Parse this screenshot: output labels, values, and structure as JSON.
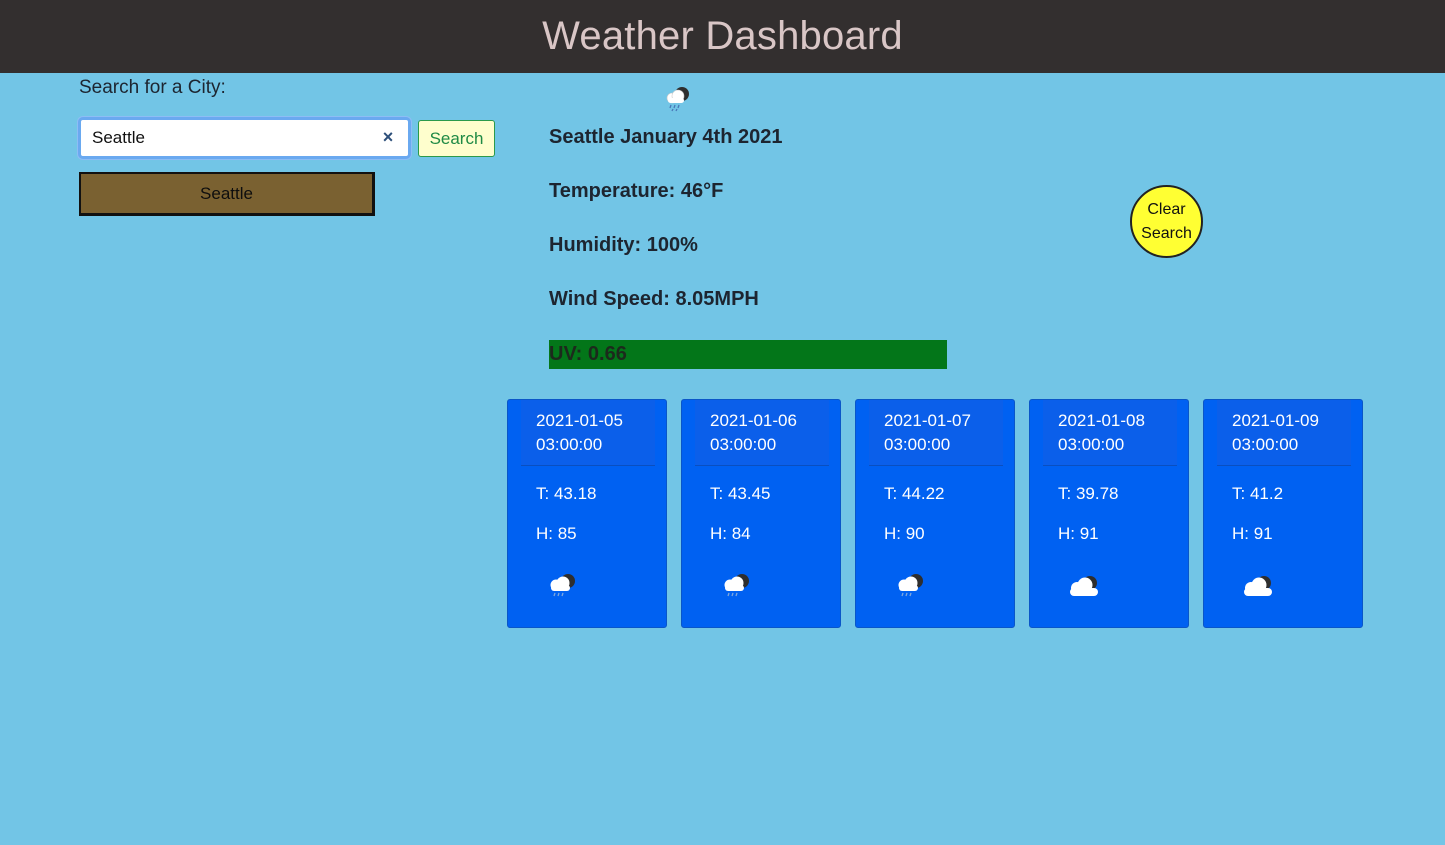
{
  "header": {
    "title": "Weather Dashboard"
  },
  "search": {
    "label": "Search for a City:",
    "value": "Seattle",
    "button_label": "Search",
    "clear_glyph": "×"
  },
  "history": [
    {
      "label": "Seattle"
    }
  ],
  "current": {
    "icon": "rain-cloud-icon",
    "title": "Seattle January 4th 2021",
    "temperature": "Temperature: 46°F",
    "humidity": "Humidity: 100%",
    "wind": "Wind Speed: 8.05MPH",
    "uv": "UV: 0.66",
    "uv_color": "#037619"
  },
  "clear_search": {
    "label": "Clear Search"
  },
  "forecast": [
    {
      "date": "2021-01-05 03:00:00",
      "temp": "T: 43.18",
      "humidity": "H: 85",
      "icon": "rain-cloud-icon"
    },
    {
      "date": "2021-01-06 03:00:00",
      "temp": "T: 43.45",
      "humidity": "H: 84",
      "icon": "rain-cloud-icon"
    },
    {
      "date": "2021-01-07 03:00:00",
      "temp": "T: 44.22",
      "humidity": "H: 90",
      "icon": "rain-cloud-icon"
    },
    {
      "date": "2021-01-08 03:00:00",
      "temp": "T: 39.78",
      "humidity": "H: 91",
      "icon": "cloud-icon"
    },
    {
      "date": "2021-01-09 03:00:00",
      "temp": "T: 41.2",
      "humidity": "H: 91",
      "icon": "cloud-icon"
    }
  ],
  "colors": {
    "page_bg": "#72c5e6",
    "header_bg": "#332f2f",
    "card_bg": "#0061f2",
    "history_bg": "#7a6131",
    "clear_button_bg": "#ffff33"
  }
}
